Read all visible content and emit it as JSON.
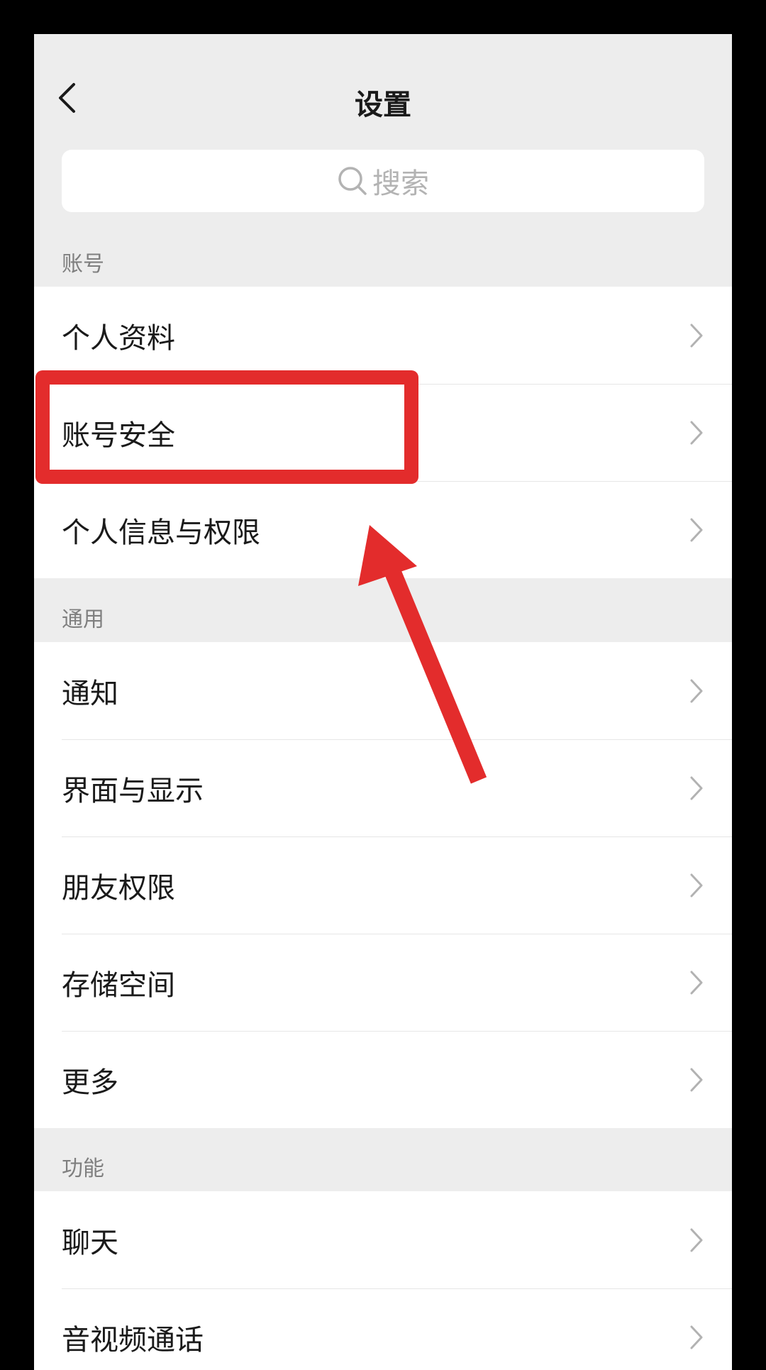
{
  "header": {
    "title": "设置"
  },
  "search": {
    "placeholder": "搜索"
  },
  "sections": [
    {
      "label": "账号",
      "items": [
        "个人资料",
        "账号安全",
        "个人信息与权限"
      ]
    },
    {
      "label": "通用",
      "items": [
        "通知",
        "界面与显示",
        "朋友权限",
        "存储空间",
        "更多"
      ]
    },
    {
      "label": "功能",
      "items": [
        "聊天",
        "音视频通话"
      ]
    }
  ],
  "colors": {
    "background": "#ededed",
    "row": "#ffffff",
    "annotation": "#e32c2c"
  }
}
